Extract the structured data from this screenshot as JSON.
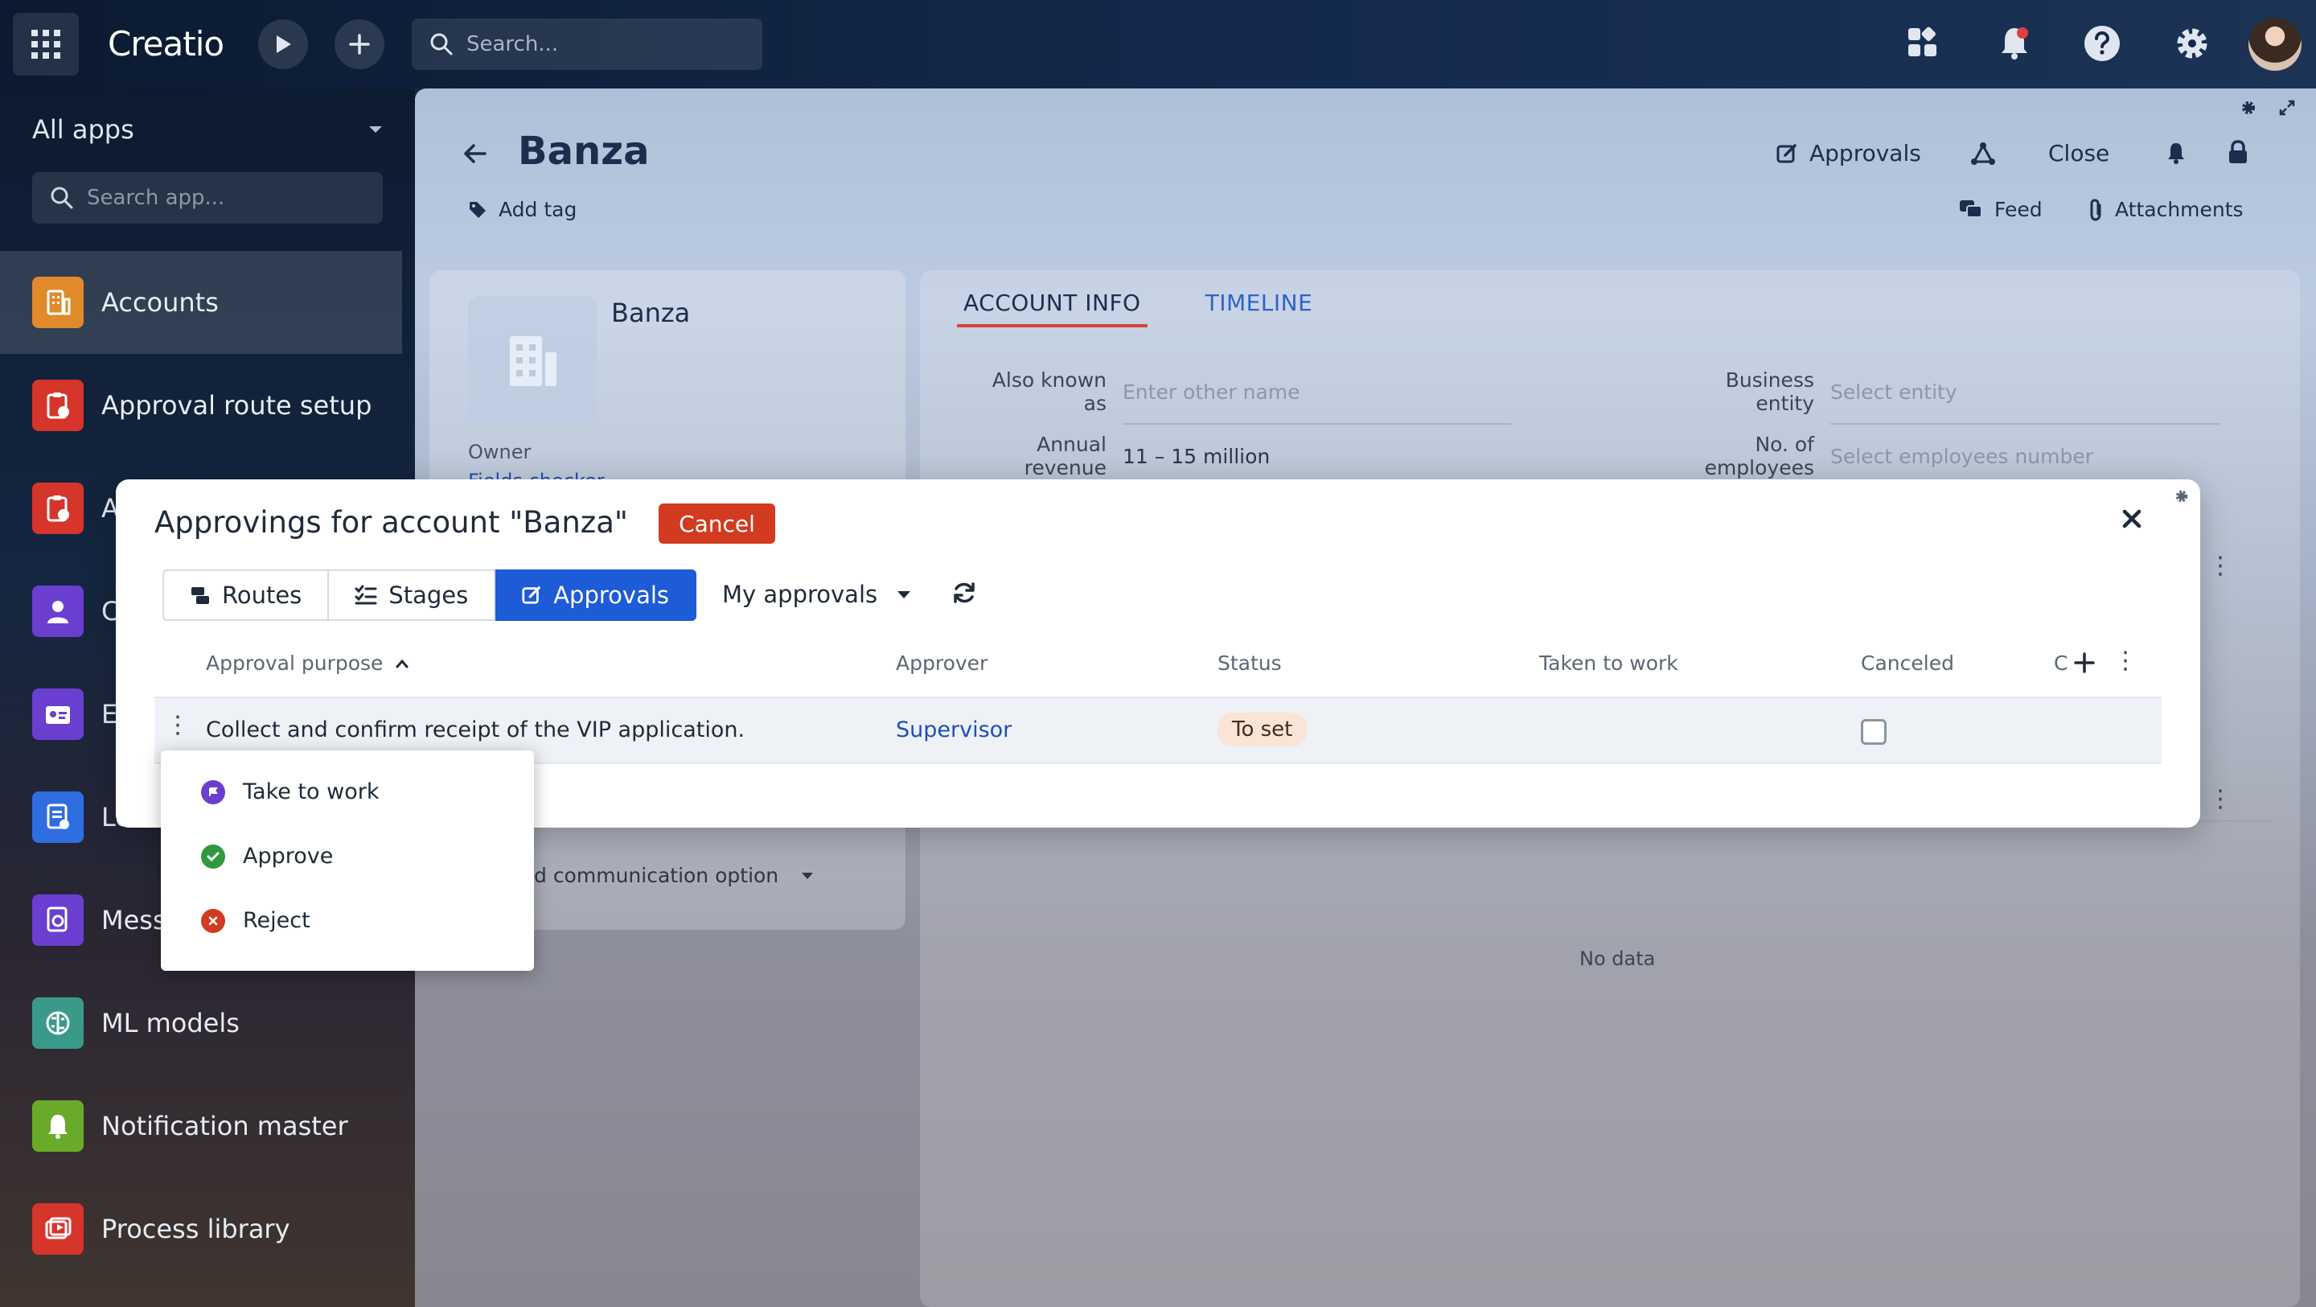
{
  "topbar": {
    "logo": "Creatio",
    "search_placeholder": "Search..."
  },
  "sidebar": {
    "header": "All apps",
    "search_placeholder": "Search app...",
    "items": [
      {
        "label": "Accounts",
        "color": "#e08a2c"
      },
      {
        "label": "Approval route setup",
        "color": "#d6352b"
      },
      {
        "label": "A",
        "color": "#d6352b"
      },
      {
        "label": "C",
        "color": "#6a3fd0"
      },
      {
        "label": "E",
        "color": "#6a3fd0"
      },
      {
        "label": "Lo",
        "color": "#2f6ee0"
      },
      {
        "label": "Mess",
        "color": "#6a3fd0"
      },
      {
        "label": "ML models",
        "color": "#3a9a8a"
      },
      {
        "label": "Notification master",
        "color": "#6aaa2a"
      },
      {
        "label": "Process library",
        "color": "#d6352b"
      }
    ]
  },
  "record": {
    "title": "Banza",
    "add_tag": "Add tag",
    "actions": {
      "approvals": "Approvals",
      "close": "Close",
      "feed": "Feed",
      "attachments": "Attachments"
    },
    "card": {
      "name": "Banza",
      "owner_label": "Owner",
      "owner_value": "Fields checker",
      "comm_option": "d communication option"
    },
    "tabs": [
      "ACCOUNT INFO",
      "TIMELINE"
    ],
    "fields": {
      "also_known_as_label": "Also known as",
      "also_known_as_ph": "Enter other name",
      "business_entity_label": "Business entity",
      "business_entity_ph": "Select entity",
      "annual_revenue_label": "Annual revenue",
      "annual_revenue_value": "11 – 15 million",
      "employees_label": "No. of employees",
      "employees_ph": "Select employees number"
    },
    "no_data": "No data"
  },
  "modal": {
    "title": "Approvings for account \"Banza\"",
    "cancel": "Cancel",
    "segments": [
      "Routes",
      "Stages",
      "Approvals"
    ],
    "filter": "My approvals",
    "columns": {
      "purpose": "Approval purpose",
      "approver": "Approver",
      "status": "Status",
      "taken": "Taken to work",
      "canceled": "Canceled",
      "more": "C"
    },
    "row": {
      "purpose": "Collect and confirm receipt of the VIP application.",
      "approver": "Supervisor",
      "status": "To set"
    }
  },
  "context_menu": {
    "items": [
      {
        "label": "Take to work",
        "color": "#6a3fd0"
      },
      {
        "label": "Approve",
        "color": "#2e9a3c"
      },
      {
        "label": "Reject",
        "color": "#d23b1f"
      }
    ]
  }
}
